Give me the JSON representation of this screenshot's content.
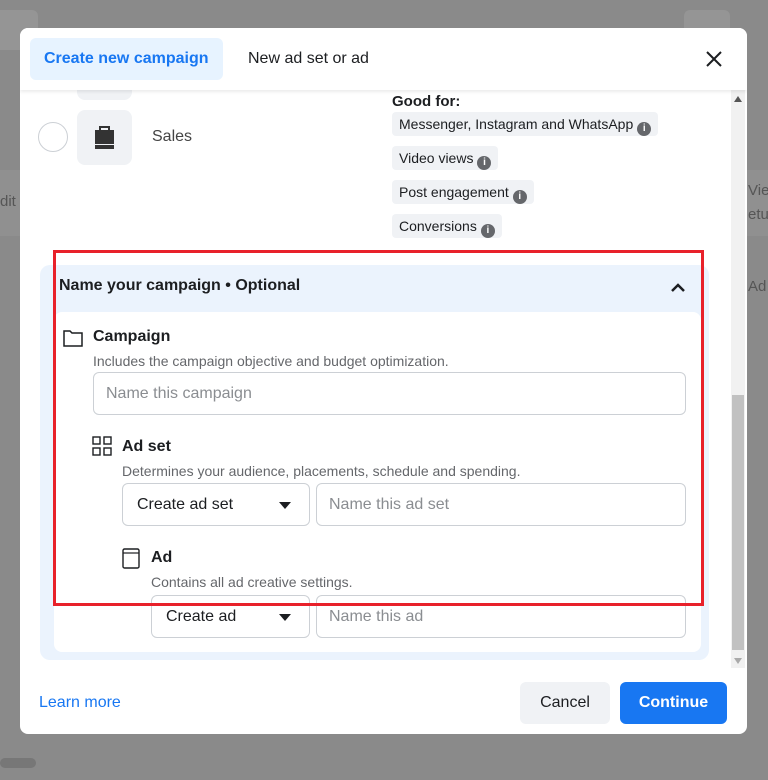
{
  "background": {
    "fragment_left": "dit",
    "fragment_right_1": "Viev",
    "fragment_right_2": "etu",
    "fragment_right_3": "Ad"
  },
  "header": {
    "tabs": [
      {
        "label": "Create new campaign",
        "active": true
      },
      {
        "label": "New ad set or ad",
        "active": false
      }
    ],
    "close_icon": "close-icon"
  },
  "objective": {
    "label": "Sales",
    "icon": "shopping-bag-icon",
    "good_for_label": "Good for:",
    "tags": [
      "Messenger, Instagram and WhatsApp",
      "Video views",
      "Post engagement",
      "Conversions"
    ]
  },
  "name_section": {
    "title": "Name your campaign • Optional",
    "campaign": {
      "title": "Campaign",
      "description": "Includes the campaign objective and budget optimization.",
      "placeholder": "Name this campaign"
    },
    "ad_set": {
      "title": "Ad set",
      "description": "Determines your audience, placements, schedule and spending.",
      "select": "Create ad set",
      "placeholder": "Name this ad set"
    },
    "ad": {
      "title": "Ad",
      "description": "Contains all ad creative settings.",
      "select": "Create ad",
      "placeholder": "Name this ad"
    }
  },
  "footer": {
    "learn_more": "Learn more",
    "cancel": "Cancel",
    "continue": "Continue"
  },
  "colors": {
    "accent": "#1877f2",
    "highlight_border": "#e8212a",
    "panel_bg": "#ebf3fd"
  }
}
